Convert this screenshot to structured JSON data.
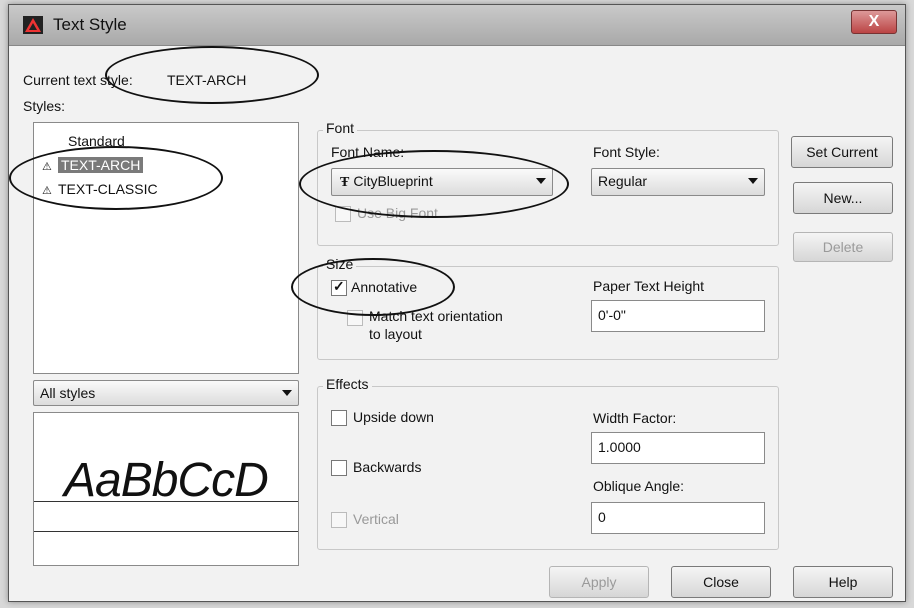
{
  "window": {
    "title": "Text Style",
    "app_icon": "autocad-icon",
    "close_label": "X"
  },
  "current_style": {
    "label": "Current text style:",
    "value": "TEXT-ARCH"
  },
  "styles": {
    "label": "Styles:",
    "items": [
      {
        "name": "Standard",
        "icon": "",
        "selected": false
      },
      {
        "name": "TEXT-ARCH",
        "icon": "annotative-icon",
        "selected": true
      },
      {
        "name": "TEXT-CLASSIC",
        "icon": "annotative-icon",
        "selected": false
      }
    ],
    "filter": "All styles",
    "preview_text": "AaBbCcD"
  },
  "font": {
    "group_label": "Font",
    "name_label": "Font Name:",
    "name_value": "CityBlueprint",
    "name_icon": "truetype-font-icon",
    "style_label": "Font Style:",
    "style_value": "Regular",
    "big_font_label": "Use Big Font"
  },
  "size": {
    "group_label": "Size",
    "annotative_label": "Annotative",
    "annotative_checked": true,
    "match_label_1": "Match text orientation",
    "match_label_2": "to layout",
    "paper_height_label": "Paper Text Height",
    "paper_height_value": "0'-0\""
  },
  "effects": {
    "group_label": "Effects",
    "upside_down": "Upside down",
    "backwards": "Backwards",
    "vertical": "Vertical",
    "width_factor_label": "Width Factor:",
    "width_factor_value": "1.0000",
    "oblique_label": "Oblique Angle:",
    "oblique_value": "0"
  },
  "buttons": {
    "set_current": "Set Current",
    "new": "New...",
    "delete": "Delete",
    "apply": "Apply",
    "close": "Close",
    "help": "Help"
  }
}
